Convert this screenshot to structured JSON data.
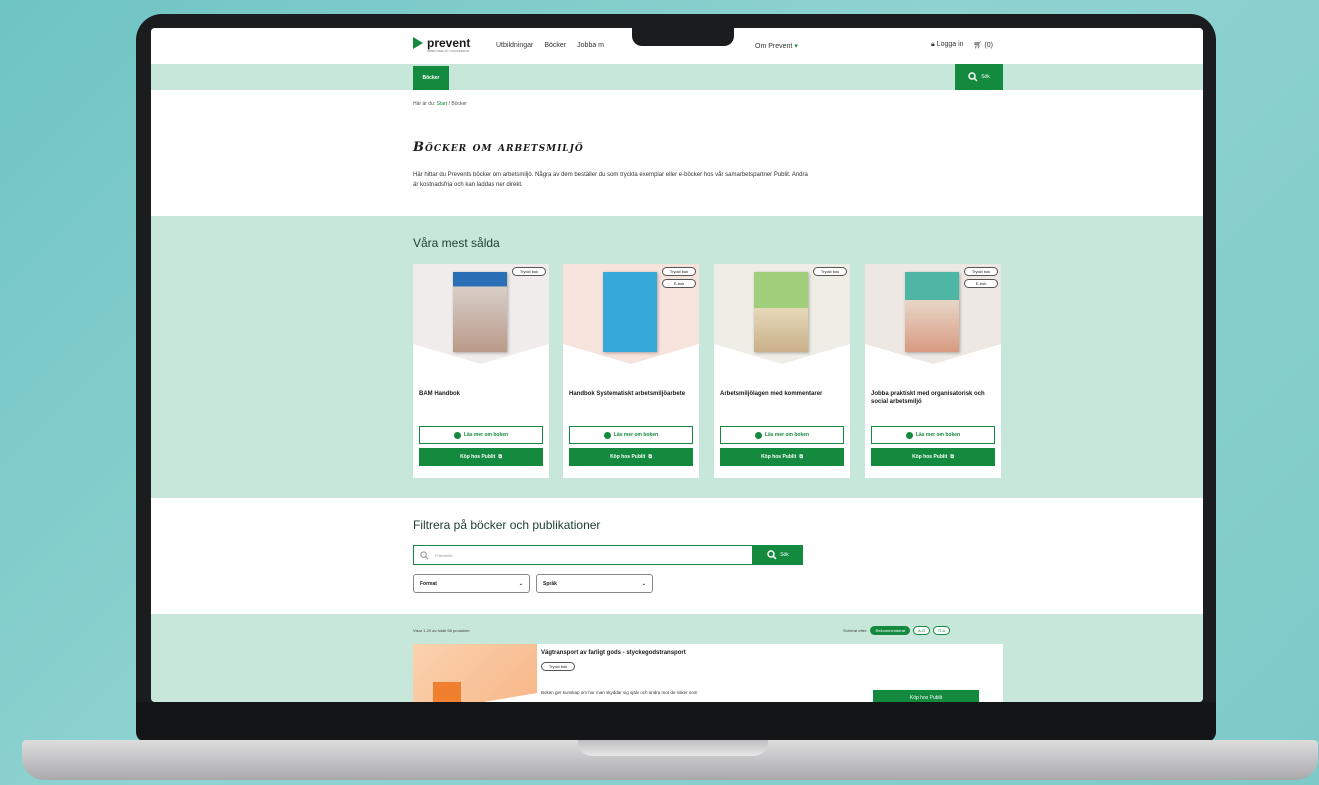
{
  "header": {
    "logo_text": "prevent",
    "logo_sub": "ARBETSMILJÖ I SAMVERKAN",
    "nav": [
      "Utbildningar",
      "Böcker",
      "Jobba m"
    ],
    "nav_right": "Om Prevent",
    "login_label": "Logga in",
    "cart_label": "(0)"
  },
  "subnav": {
    "active_tab": "Böcker",
    "search_label": "Sök"
  },
  "breadcrumb": {
    "prefix": "Här är du:",
    "home": "Start",
    "separator": "/",
    "current": "Böcker"
  },
  "main": {
    "title": "Böcker om arbetsmiljö",
    "intro": "Här hittar du Prevents böcker om arbetsmiljö. Några av dem beställer du som tryckta exemplar eller e-böcker hos vår samarbetspartner Publit. Andra är kostnadsfria och kan laddas ner direkt."
  },
  "bestsellers": {
    "title": "Våra mest sålda",
    "cards": [
      {
        "title": "BAM Handbok",
        "badges": [
          "Tryckt bok"
        ],
        "read_label": "Läs mer om boken",
        "buy_label": "Köp hos Publit",
        "cover_color": "#2a6fb5"
      },
      {
        "title": "Handbok Systematiskt arbetsmiljöarbete",
        "badges": [
          "Tryckt bok",
          "E-bok"
        ],
        "read_label": "Läs mer om boken",
        "buy_label": "Köp hos Publit",
        "cover_color": "#36a9d8"
      },
      {
        "title": "Arbetsmiljölagen med kommentarer",
        "badges": [
          "Tryckt bok"
        ],
        "read_label": "Läs mer om boken",
        "buy_label": "Köp hos Publit",
        "cover_color": "#9fcf7a"
      },
      {
        "title": "Jobba praktiskt med organisatorisk och social arbetsmiljö",
        "badges": [
          "Tryckt bok",
          "E-bok"
        ],
        "read_label": "Läs mer om boken",
        "buy_label": "Köp hos Publit",
        "cover_color": "#4fb6a6"
      }
    ]
  },
  "filter": {
    "title": "Filtrera på böcker och publikationer",
    "placeholder": "Fritextsök",
    "search_label": "Sök",
    "format_label": "Format",
    "language_label": "Språk"
  },
  "results": {
    "count_text": "Visar 1-20 av totalt 58 produkter",
    "sort_label": "Sorterat efter:",
    "sort_options": [
      "Rekommenderat",
      "A-Ö",
      "Ö-A"
    ],
    "item": {
      "title": "Vägtransport av farligt gods - styckegodstransport",
      "badge": "Tryckt bok",
      "desc": "Boken ger kunskap om hur man skyddar sig själv och andra mot de risker som",
      "buy_label": "Köp hos Publit"
    }
  },
  "colors": {
    "brand_green": "#138a3e",
    "mint": "#c6e7da",
    "background_teal": "#7ecac8"
  }
}
